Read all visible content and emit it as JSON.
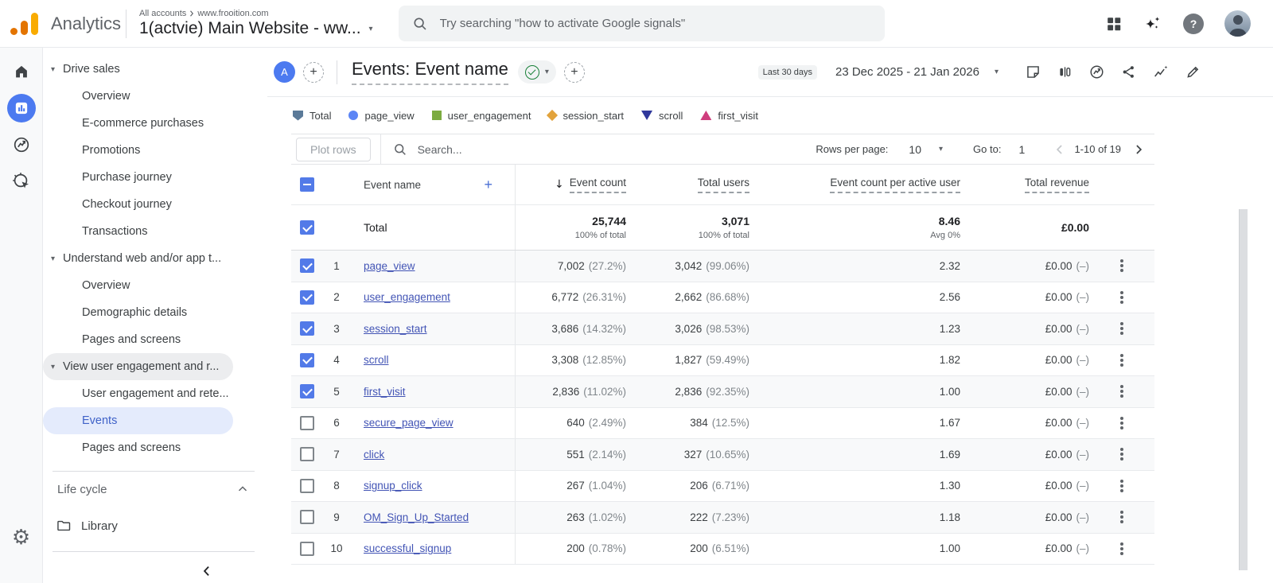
{
  "icons": {
    "plus": "+",
    "caret_down": "▾",
    "sort_desc_arrow": "↓",
    "question_mark": "?"
  },
  "colors": {
    "checkbox_blue": "#527ae8",
    "link_blue": "#4254b5",
    "active_nav_bg": "#e4ebfc",
    "active_nav_text": "#3f62c8",
    "logo_amber": "#f9ab00",
    "logo_orange": "#e37400",
    "rail_active_blue": "#4c7af0",
    "status_check_green": "#188038"
  },
  "topbar": {
    "product_name": "Analytics",
    "breadcrumb": {
      "root": "All accounts",
      "site": "www.frooition.com"
    },
    "property_selector": "1(actvie) Main Website - ww...",
    "search_placeholder": "Try searching \"how to activate Google signals\""
  },
  "rail": {
    "items": [
      "home",
      "reports",
      "explore",
      "advertising",
      "settings"
    ]
  },
  "sidebar": {
    "items": [
      {
        "label": "Drive sales",
        "kind": "group"
      },
      {
        "label": "Overview",
        "kind": "child"
      },
      {
        "label": "E-commerce purchases",
        "kind": "child"
      },
      {
        "label": "Promotions",
        "kind": "child"
      },
      {
        "label": "Purchase journey",
        "kind": "child"
      },
      {
        "label": "Checkout journey",
        "kind": "child"
      },
      {
        "label": "Transactions",
        "kind": "child"
      },
      {
        "label": "Understand web and/or app t...",
        "kind": "group"
      },
      {
        "label": "Overview",
        "kind": "child"
      },
      {
        "label": "Demographic details",
        "kind": "child"
      },
      {
        "label": "Pages and screens",
        "kind": "child"
      },
      {
        "label": "View user engagement and r...",
        "kind": "group",
        "state": "hover"
      },
      {
        "label": "User engagement and rete...",
        "kind": "child"
      },
      {
        "label": "Events",
        "kind": "child",
        "state": "active"
      },
      {
        "label": "Pages and screens",
        "kind": "child"
      }
    ],
    "section_label": "Life cycle",
    "library_label": "Library"
  },
  "report_header": {
    "workspace_letter": "A",
    "title": "Events: Event name",
    "date_preset": "Last 30 days",
    "date_range": "23 Dec 2025 - 21 Jan 2026"
  },
  "legend": {
    "items": [
      {
        "label": "Total",
        "shape": "pentagon",
        "color": "#5b7a99"
      },
      {
        "label": "page_view",
        "shape": "circle",
        "color": "#5c85f5"
      },
      {
        "label": "user_engagement",
        "shape": "square",
        "color": "#7cab40"
      },
      {
        "label": "session_start",
        "shape": "diamond",
        "color": "#e2a33c"
      },
      {
        "label": "scroll",
        "shape": "triangle-down",
        "color": "#30389c"
      },
      {
        "label": "first_visit",
        "shape": "triangle-up",
        "color": "#cf3d7d"
      }
    ]
  },
  "controls": {
    "plot_rows_label": "Plot rows",
    "search_placeholder": "Search...",
    "rows_per_page_label": "Rows per page:",
    "rows_per_page_value": "10",
    "goto_label": "Go to:",
    "goto_value": "1",
    "pagination_range": "1-10 of 19"
  },
  "table": {
    "columns": {
      "event_name": "Event name",
      "event_count": "Event count",
      "total_users": "Total users",
      "event_count_per_active_user": "Event count per active user",
      "total_revenue": "Total revenue"
    },
    "total_row": {
      "label": "Total",
      "event_count": "25,744",
      "event_count_sub": "100% of total",
      "total_users": "3,071",
      "total_users_sub": "100% of total",
      "per_active_user": "8.46",
      "per_active_user_sub": "Avg 0%",
      "revenue": "£0.00"
    },
    "rows": [
      {
        "rank": "1",
        "name": "page_view",
        "checked": true,
        "event_count": "7,002",
        "event_count_pct": "(27.2%)",
        "total_users": "3,042",
        "total_users_pct": "(99.06%)",
        "per_active_user": "2.32",
        "revenue": "£0.00",
        "revenue_note": "(–)"
      },
      {
        "rank": "2",
        "name": "user_engagement",
        "checked": true,
        "event_count": "6,772",
        "event_count_pct": "(26.31%)",
        "total_users": "2,662",
        "total_users_pct": "(86.68%)",
        "per_active_user": "2.56",
        "revenue": "£0.00",
        "revenue_note": "(–)"
      },
      {
        "rank": "3",
        "name": "session_start",
        "checked": true,
        "event_count": "3,686",
        "event_count_pct": "(14.32%)",
        "total_users": "3,026",
        "total_users_pct": "(98.53%)",
        "per_active_user": "1.23",
        "revenue": "£0.00",
        "revenue_note": "(–)"
      },
      {
        "rank": "4",
        "name": "scroll",
        "checked": true,
        "event_count": "3,308",
        "event_count_pct": "(12.85%)",
        "total_users": "1,827",
        "total_users_pct": "(59.49%)",
        "per_active_user": "1.82",
        "revenue": "£0.00",
        "revenue_note": "(–)"
      },
      {
        "rank": "5",
        "name": "first_visit",
        "checked": true,
        "event_count": "2,836",
        "event_count_pct": "(11.02%)",
        "total_users": "2,836",
        "total_users_pct": "(92.35%)",
        "per_active_user": "1.00",
        "revenue": "£0.00",
        "revenue_note": "(–)"
      },
      {
        "rank": "6",
        "name": "secure_page_view",
        "checked": false,
        "event_count": "640",
        "event_count_pct": "(2.49%)",
        "total_users": "384",
        "total_users_pct": "(12.5%)",
        "per_active_user": "1.67",
        "revenue": "£0.00",
        "revenue_note": "(–)"
      },
      {
        "rank": "7",
        "name": "click",
        "checked": false,
        "event_count": "551",
        "event_count_pct": "(2.14%)",
        "total_users": "327",
        "total_users_pct": "(10.65%)",
        "per_active_user": "1.69",
        "revenue": "£0.00",
        "revenue_note": "(–)"
      },
      {
        "rank": "8",
        "name": "signup_click",
        "checked": false,
        "event_count": "267",
        "event_count_pct": "(1.04%)",
        "total_users": "206",
        "total_users_pct": "(6.71%)",
        "per_active_user": "1.30",
        "revenue": "£0.00",
        "revenue_note": "(–)"
      },
      {
        "rank": "9",
        "name": "OM_Sign_Up_Started",
        "checked": false,
        "event_count": "263",
        "event_count_pct": "(1.02%)",
        "total_users": "222",
        "total_users_pct": "(7.23%)",
        "per_active_user": "1.18",
        "revenue": "£0.00",
        "revenue_note": "(–)"
      },
      {
        "rank": "10",
        "name": "successful_signup",
        "checked": false,
        "event_count": "200",
        "event_count_pct": "(0.78%)",
        "total_users": "200",
        "total_users_pct": "(6.51%)",
        "per_active_user": "1.00",
        "revenue": "£0.00",
        "revenue_note": "(–)"
      }
    ]
  }
}
